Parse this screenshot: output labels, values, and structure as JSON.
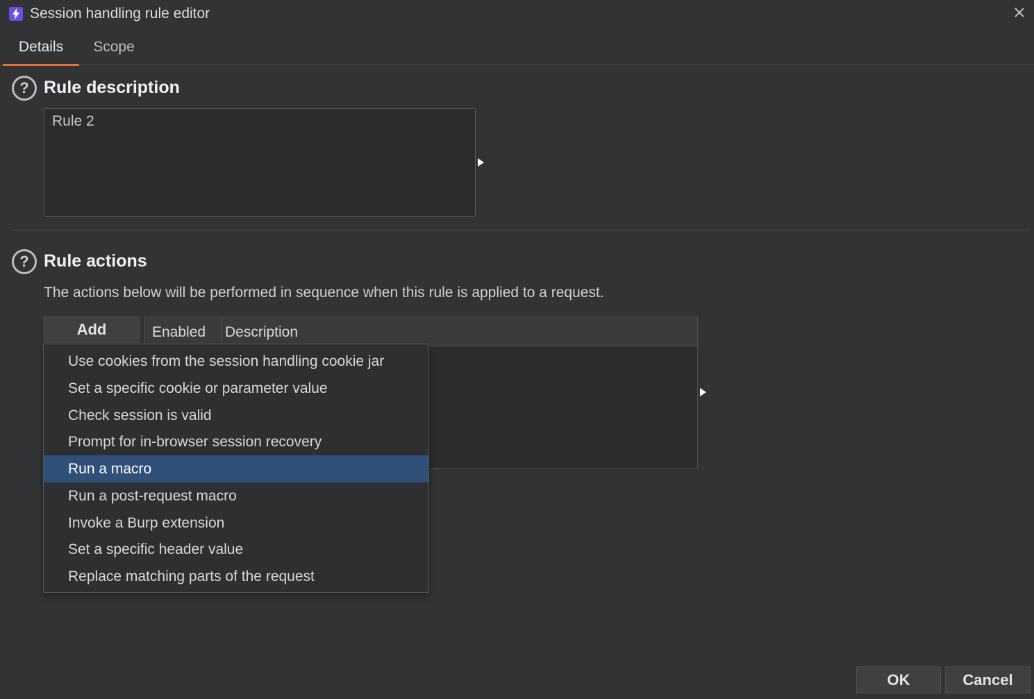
{
  "window": {
    "title": "Session handling rule editor"
  },
  "tabs": [
    {
      "label": "Details",
      "active": true
    },
    {
      "label": "Scope",
      "active": false
    }
  ],
  "rule_description": {
    "heading": "Rule description",
    "value": "Rule 2"
  },
  "rule_actions": {
    "heading": "Rule actions",
    "info": "The actions below will be performed in sequence when this rule is applied to a request.",
    "add_label": "Add",
    "columns": [
      "Enabled",
      "Description"
    ],
    "rows": []
  },
  "add_menu": {
    "items": [
      "Use cookies from the session handling cookie jar",
      "Set a specific cookie or parameter value",
      "Check session is valid",
      "Prompt for in-browser session recovery",
      "Run a macro",
      "Run a post-request macro",
      "Invoke a Burp extension",
      "Set a specific header value",
      "Replace matching parts of the request"
    ],
    "selected": "Run a macro"
  },
  "footer": {
    "ok_label": "OK",
    "cancel_label": "Cancel"
  },
  "icons": {
    "app": "lightning-icon",
    "close": "close-icon",
    "help": "help-icon",
    "expand": "expand-arrow-icon"
  },
  "colors": {
    "background": "#323335",
    "accent_tab": "#e8713a",
    "selection": "#2f5078",
    "app_icon": "#6b4fe0"
  }
}
